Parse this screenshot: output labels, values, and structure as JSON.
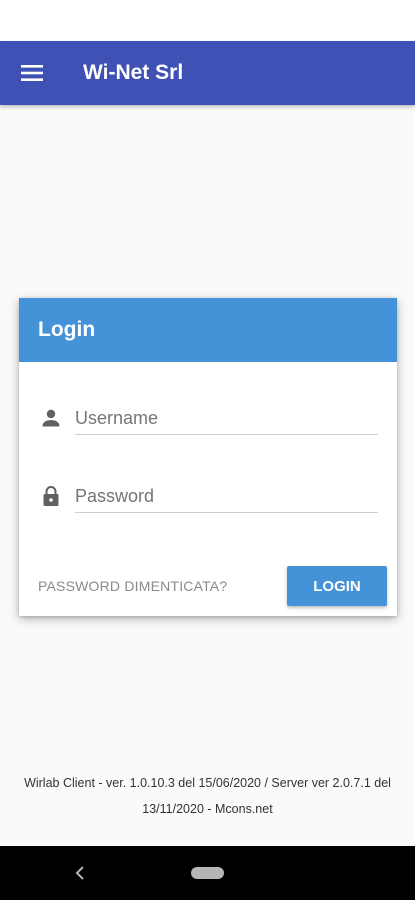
{
  "app_bar": {
    "title": "Wi-Net Srl",
    "menu_icon": "menu-icon",
    "color": "#3f51b5"
  },
  "login_card": {
    "title": "Login",
    "header_color": "#4493d8",
    "username": {
      "icon": "person-icon",
      "placeholder": "Username",
      "value": ""
    },
    "password": {
      "icon": "lock-icon",
      "placeholder": "Password",
      "value": ""
    },
    "forgot_password_label": "PASSWORD DIMENTICATA?",
    "login_button_label": "LOGIN"
  },
  "footer": {
    "line1": "Wirlab Client - ver. 1.0.10.3 del 15/06/2020 / Server ver 2.0.7.1 del",
    "line2": "13/11/2020 - Mcons.net"
  },
  "system_nav": {
    "back_icon": "back-icon",
    "home_icon": "home-pill-icon"
  }
}
